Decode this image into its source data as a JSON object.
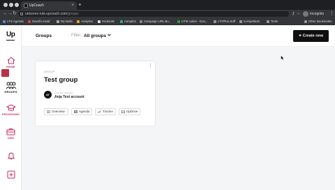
{
  "browser": {
    "tab_title": "UpCoach",
    "tab_close": "×",
    "new_tab": "+",
    "url_host": "unicorns-rule.upcoach.com",
    "url_path": "/groups",
    "profile_label": "Incognito",
    "bookmarks": [
      {
        "label": "LTG Agenda",
        "color": "#5c89d6"
      },
      {
        "label": "David's email",
        "color": "#d44638"
      },
      {
        "label": "My tasks",
        "color": "#aaaaaa"
      },
      {
        "label": "Analytics",
        "color": "#f4a023"
      },
      {
        "label": "Hootsuite",
        "color": "#dddddd"
      },
      {
        "label": "Autopilot",
        "color": "#2db36b"
      },
      {
        "label": "Campaign URL Bu...",
        "color": "#888888"
      },
      {
        "label": "UTM codes - Goo...",
        "color": "#2f9e44"
      },
      {
        "label": "LTVPlus stuff",
        "color": "#999999"
      },
      {
        "label": "Competitors",
        "color": "#999999"
      },
      {
        "label": "Tools",
        "color": "#999999"
      },
      {
        "label": "Other Bookmarks",
        "color": "#999999"
      }
    ]
  },
  "sidebar": {
    "logo": "Up",
    "items": [
      {
        "label": "HOME",
        "icon": "home-icon"
      },
      {
        "label": "GROUPS",
        "icon": "groups-icon"
      },
      {
        "label": "PROGRAMS",
        "icon": "graduation-cap-icon"
      },
      {
        "label": "ORG",
        "icon": "briefcase-icon"
      },
      {
        "label": "",
        "icon": "bell-icon"
      },
      {
        "label": "",
        "icon": "plus-square-icon"
      }
    ]
  },
  "header": {
    "title": "Groups",
    "filter_label": "Filter:",
    "filter_value": "All groups",
    "create_button": "Create new"
  },
  "groups": [
    {
      "kicker": "GROUP",
      "title": "Test group",
      "owner_label": "GROUP OWNER",
      "owner_initials": "AT",
      "owner_name": "Anja Test account",
      "actions": [
        "Overview",
        "Agenda",
        "Tracker",
        "UpDrive"
      ]
    }
  ],
  "colors": {
    "accent": "#c8285c",
    "primary_button": "#0f0f0f",
    "background": "#f4f5f7"
  }
}
